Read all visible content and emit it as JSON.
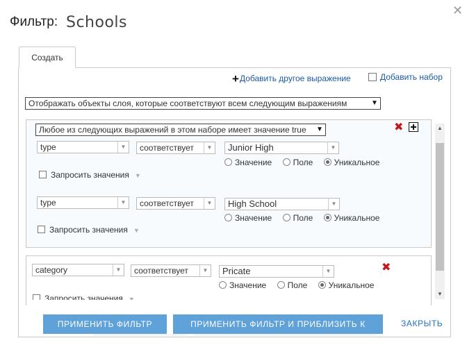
{
  "header": {
    "title_prefix": "Фильтр:",
    "layer_name": "Schools"
  },
  "tab": {
    "label": "Создать"
  },
  "toolbar": {
    "add_expression": "Добавить другое выражение",
    "add_set": "Добавить набор"
  },
  "match_select": {
    "value": "Отображать объекты слоя, которые соответствуют всем следующим выражениям"
  },
  "set": {
    "match_select": "Любое из следующих выражений в этом наборе имеет значение true",
    "expressions": [
      {
        "field": "type",
        "operator": "соответствует",
        "value": "Junior High",
        "options": [
          "Значение",
          "Поле",
          "Уникальное"
        ],
        "selected_option": "Уникальное",
        "ask_values": "Запросить значения"
      },
      {
        "field": "type",
        "operator": "соответствует",
        "value": "High School",
        "options": [
          "Значение",
          "Поле",
          "Уникальное"
        ],
        "selected_option": "Уникальное",
        "ask_values": "Запросить значения"
      }
    ]
  },
  "expression": {
    "field": "category",
    "operator": "соответствует",
    "value": "Pricate",
    "options": [
      "Значение",
      "Поле",
      "Уникальное"
    ],
    "selected_option": "Уникальное",
    "ask_values": "Запросить значения"
  },
  "buttons": {
    "apply": "ПРИМЕНИТЬ ФИЛЬТР",
    "apply_zoom": "ПРИМЕНИТЬ ФИЛЬТР И ПРИБЛИЗИТЬ К",
    "close": "ЗАКРЫТЬ"
  },
  "icons": {
    "close": "close-icon",
    "plus": "plus-icon",
    "delete": "red-x-icon",
    "add_to_set": "add-square-icon"
  },
  "colors": {
    "accent_button": "#5fa1d9",
    "link": "#1a5aa5",
    "delete": "#c0181c"
  }
}
